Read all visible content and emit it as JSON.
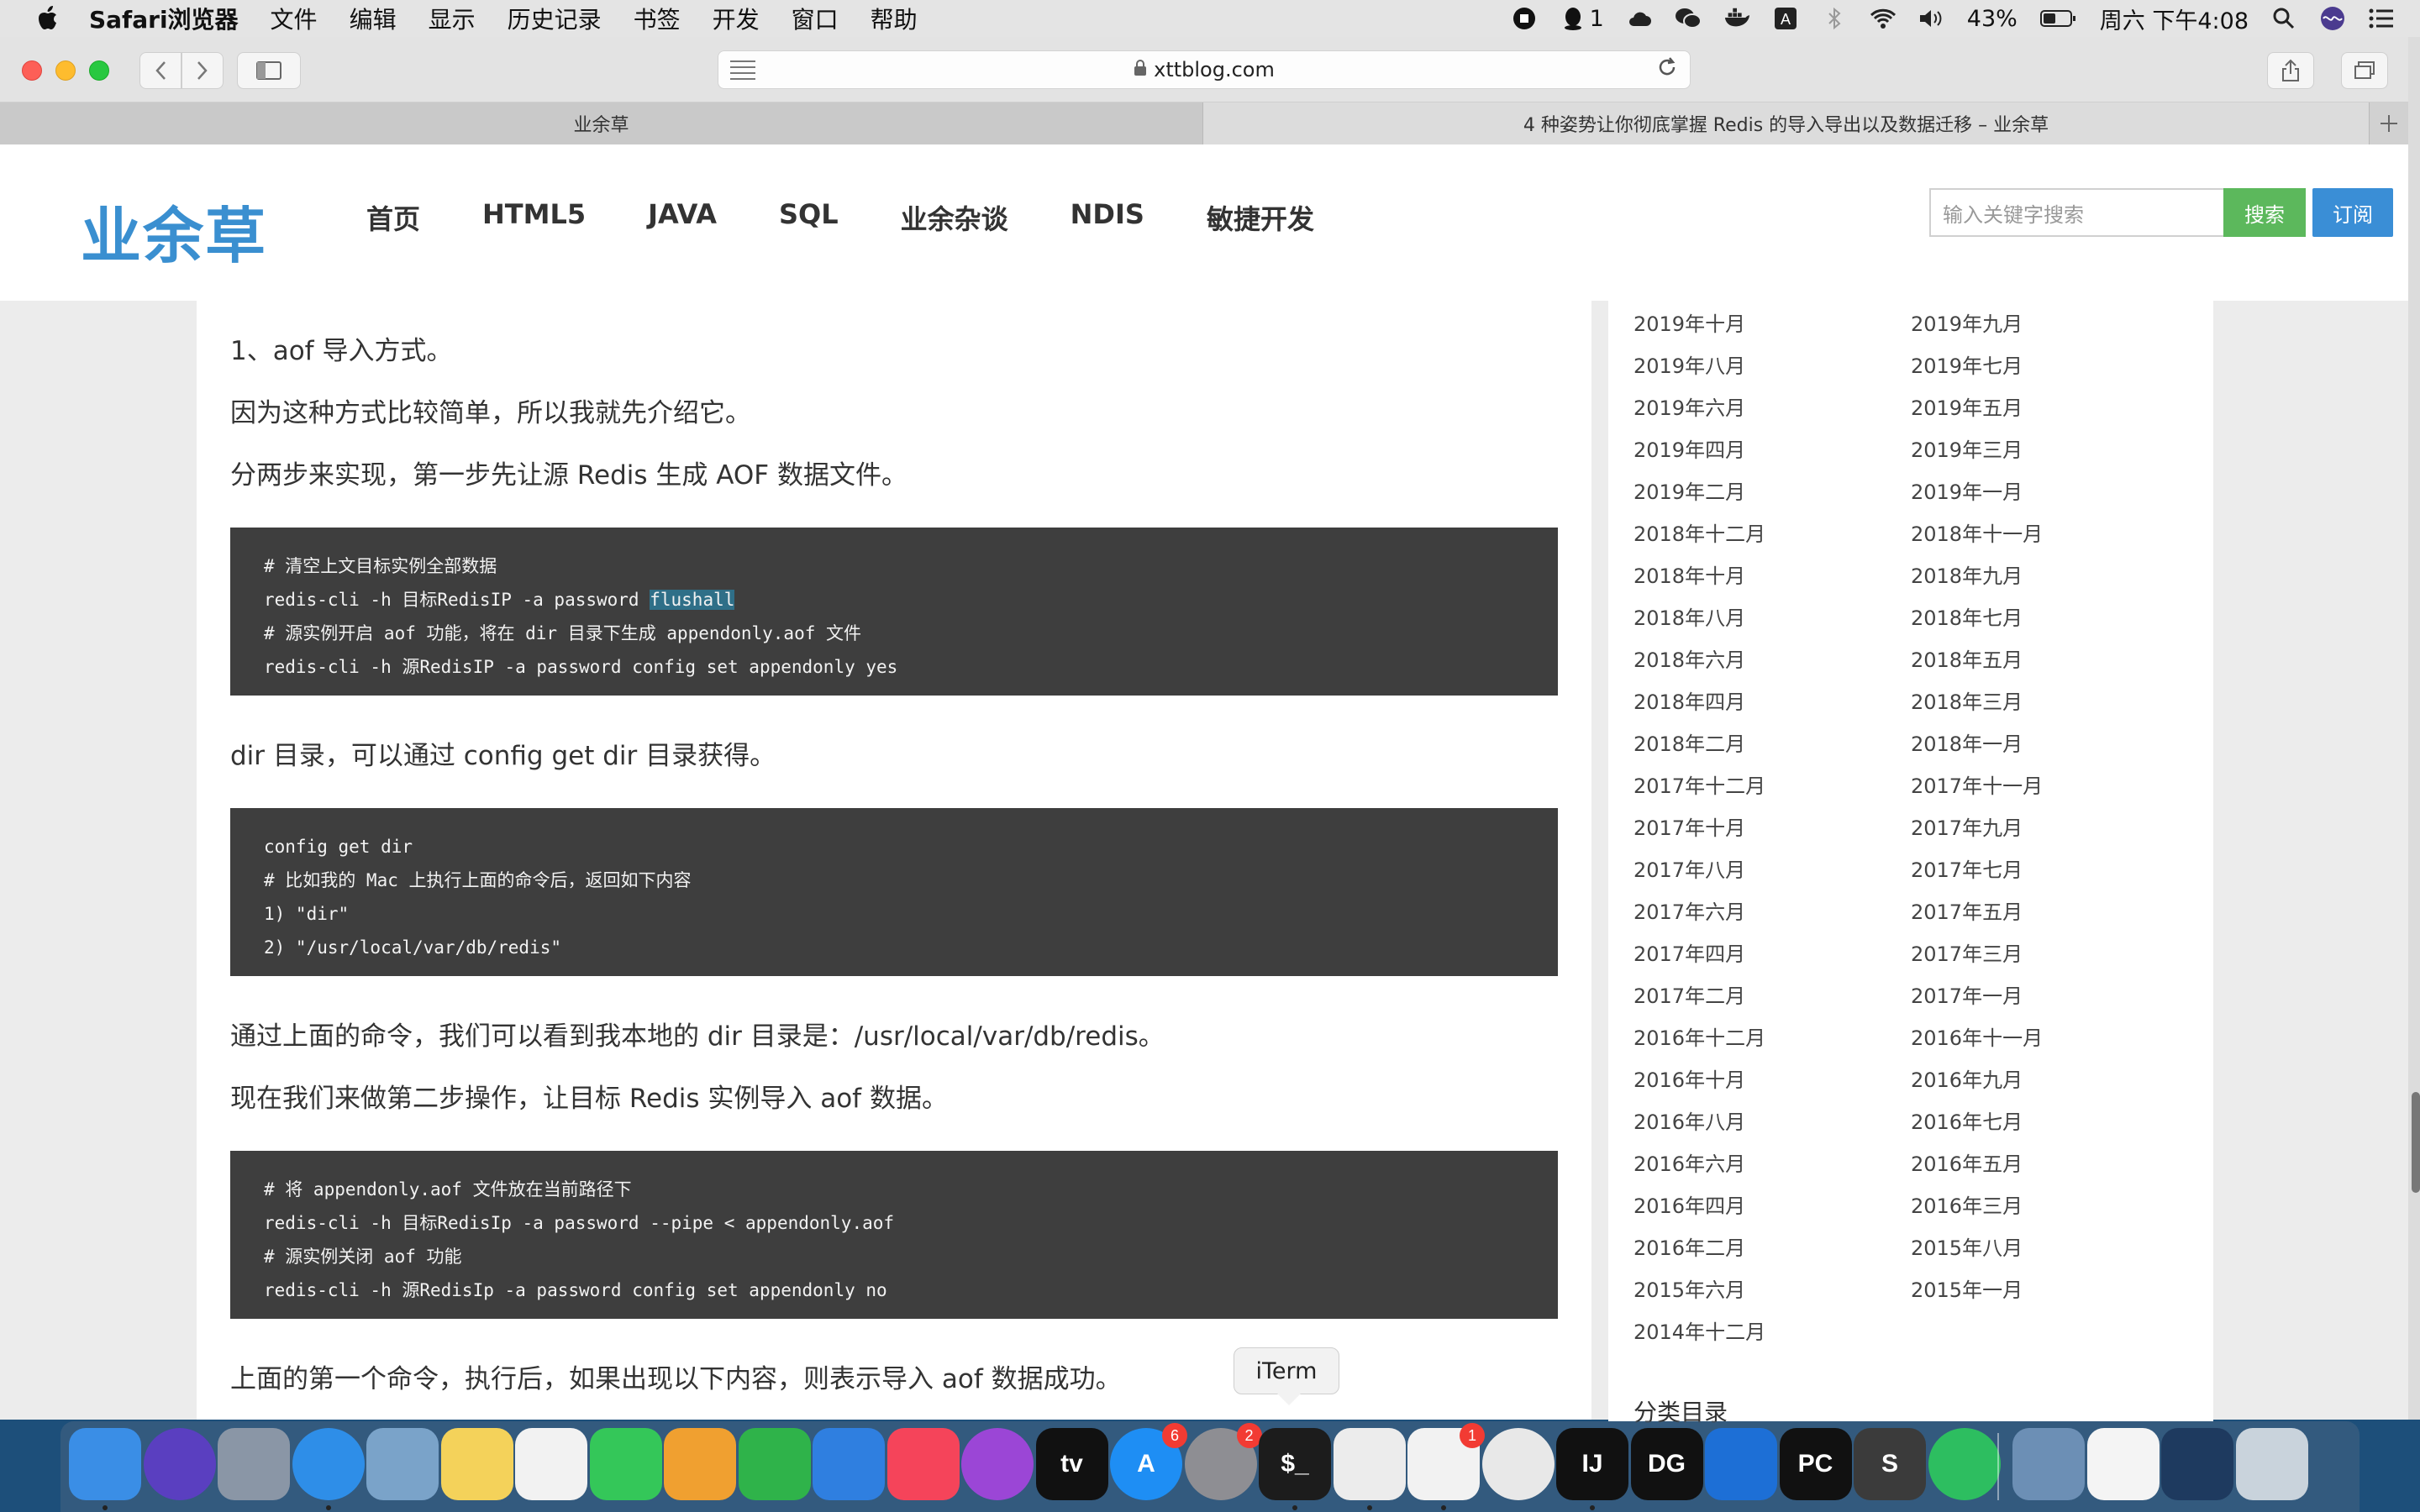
{
  "menubar": {
    "app_name": "Safari浏览器",
    "items": [
      "文件",
      "编辑",
      "显示",
      "历史记录",
      "书签",
      "开发",
      "窗口",
      "帮助"
    ],
    "qq_count": "1",
    "battery": "43%",
    "clock": "周六 下午4:08"
  },
  "browser": {
    "url": "xttblog.com",
    "tabs": [
      {
        "title": "业余草"
      },
      {
        "title": "4 种姿势让你彻底掌握 Redis 的导入导出以及数据迁移 – 业余草"
      }
    ]
  },
  "site": {
    "logo": "业余草",
    "nav": [
      "首页",
      "HTML5",
      "JAVA",
      "SQL",
      "业余杂谈",
      "NDIS",
      "敏捷开发"
    ],
    "search_placeholder": "输入关键字搜索",
    "search_button": "搜索",
    "subscribe_button": "订阅"
  },
  "article": {
    "p1": "1、aof 导入方式。",
    "p2": "因为这种方式比较简单，所以我就先介绍它。",
    "p3": "分两步来实现，第一步先让源 Redis 生成 AOF 数据文件。",
    "code1": [
      "# 清空上文目标实例全部数据",
      "redis-cli -h 目标RedisIP -a password ",
      "# 源实例开启 aof 功能，将在 dir 目录下生成 appendonly.aof 文件",
      "redis-cli -h 源RedisIP -a password config set appendonly yes"
    ],
    "code1_highlight": "flushall",
    "p4": "dir 目录，可以通过 config get dir 目录获得。",
    "code2": [
      "config get dir",
      "# 比如我的 Mac 上执行上面的命令后，返回如下内容",
      "1) \"dir\"",
      "2) \"/usr/local/var/db/redis\""
    ],
    "p5": "通过上面的命令，我们可以看到我本地的 dir 目录是：/usr/local/var/db/redis。",
    "p6": "现在我们来做第二步操作，让目标 Redis 实例导入 aof 数据。",
    "code3": [
      "# 将 appendonly.aof 文件放在当前路径下",
      "redis-cli -h 目标RedisIp -a password --pipe < appendonly.aof",
      "# 源实例关闭 aof 功能",
      "redis-cli -h 源RedisIp -a password config set appendonly no"
    ],
    "p7": "上面的第一个命令，执行后，如果出现以下内容，则表示导入 aof 数据成功。"
  },
  "sidebar": {
    "archives": [
      "2019年十月",
      "2019年九月",
      "2019年八月",
      "2019年七月",
      "2019年六月",
      "2019年五月",
      "2019年四月",
      "2019年三月",
      "2019年二月",
      "2019年一月",
      "2018年十二月",
      "2018年十一月",
      "2018年十月",
      "2018年九月",
      "2018年八月",
      "2018年七月",
      "2018年六月",
      "2018年五月",
      "2018年四月",
      "2018年三月",
      "2018年二月",
      "2018年一月",
      "2017年十二月",
      "2017年十一月",
      "2017年十月",
      "2017年九月",
      "2017年八月",
      "2017年七月",
      "2017年六月",
      "2017年五月",
      "2017年四月",
      "2017年三月",
      "2017年二月",
      "2017年一月",
      "2016年十二月",
      "2016年十一月",
      "2016年十月",
      "2016年九月",
      "2016年八月",
      "2016年七月",
      "2016年六月",
      "2016年五月",
      "2016年四月",
      "2016年三月",
      "2016年二月",
      "2015年八月",
      "2015年六月",
      "2015年一月",
      "2014年十二月"
    ],
    "category_title": "分类目录"
  },
  "tooltip": "iTerm",
  "dock": {
    "apps": [
      {
        "name": "finder-icon",
        "label": "",
        "color": "#3a8ee6",
        "badge": "",
        "running": true
      },
      {
        "name": "siri-icon",
        "label": "",
        "color": "#5a3fc0",
        "badge": "",
        "running": false
      },
      {
        "name": "launchpad-icon",
        "label": "",
        "color": "#8a96a6",
        "badge": "",
        "running": false
      },
      {
        "name": "safari-icon",
        "label": "",
        "color": "#2e8ee8",
        "badge": "",
        "running": true
      },
      {
        "name": "mail-bird-icon",
        "label": "",
        "color": "#7aa3c9",
        "badge": "",
        "running": false
      },
      {
        "name": "notes-icon",
        "label": "",
        "color": "#f4d25a",
        "badge": "",
        "running": false
      },
      {
        "name": "photos-icon",
        "label": "",
        "color": "#f2f2f2",
        "badge": "",
        "running": false
      },
      {
        "name": "facetime-icon",
        "label": "",
        "color": "#34c759",
        "badge": "",
        "running": false
      },
      {
        "name": "pages-icon",
        "label": "",
        "color": "#f0a030",
        "badge": "",
        "running": false
      },
      {
        "name": "numbers-icon",
        "label": "",
        "color": "#2fb34a",
        "badge": "",
        "running": false
      },
      {
        "name": "keynote-icon",
        "label": "",
        "color": "#2f7fe0",
        "badge": "",
        "running": false
      },
      {
        "name": "music-icon",
        "label": "",
        "color": "#f5445a",
        "badge": "",
        "running": false
      },
      {
        "name": "podcasts-icon",
        "label": "",
        "color": "#9b46d6",
        "badge": "",
        "running": false
      },
      {
        "name": "apple-tv-icon",
        "label": "tv",
        "color": "#111111",
        "badge": "",
        "running": false
      },
      {
        "name": "app-store-icon",
        "label": "A",
        "color": "#1e8ef4",
        "badge": "6",
        "running": false
      },
      {
        "name": "system-preferences-icon",
        "label": "",
        "color": "#8e8e93",
        "badge": "2",
        "running": false
      },
      {
        "name": "iterm-icon",
        "label": "$_",
        "color": "#1c1c1c",
        "badge": "",
        "running": true
      },
      {
        "name": "wechat-icon",
        "label": "",
        "color": "#ececec",
        "badge": "",
        "running": true
      },
      {
        "name": "qq-icon",
        "label": "",
        "color": "#f2f2f2",
        "badge": "1",
        "running": true
      },
      {
        "name": "chrome-icon",
        "label": "",
        "color": "#e8e8e8",
        "badge": "",
        "running": false
      },
      {
        "name": "intellij-icon",
        "label": "IJ",
        "color": "#111111",
        "badge": "",
        "running": true
      },
      {
        "name": "datagrip-icon",
        "label": "DG",
        "color": "#111111",
        "badge": "",
        "running": false
      },
      {
        "name": "sourcetree-icon",
        "label": "",
        "color": "#1d6fd6",
        "badge": "",
        "running": false
      },
      {
        "name": "pycharm-icon",
        "label": "PC",
        "color": "#111111",
        "badge": "",
        "running": false
      },
      {
        "name": "sublime-icon",
        "label": "S",
        "color": "#3b3b3b",
        "badge": "",
        "running": false
      },
      {
        "name": "evernote-icon",
        "label": "",
        "color": "#2dbe60",
        "badge": "",
        "running": false
      },
      {
        "name": "preview-icon",
        "label": "",
        "color": "#6c8fb5",
        "badge": "",
        "running": false
      },
      {
        "name": "textedit-icon",
        "label": "",
        "color": "#f4f4f4",
        "badge": "",
        "running": false
      },
      {
        "name": "quicktime-icon",
        "label": "",
        "color": "#1e3a5f",
        "badge": "",
        "running": false
      },
      {
        "name": "trash-icon",
        "label": "",
        "color": "#c9d3dc",
        "badge": "",
        "running": false
      }
    ]
  }
}
